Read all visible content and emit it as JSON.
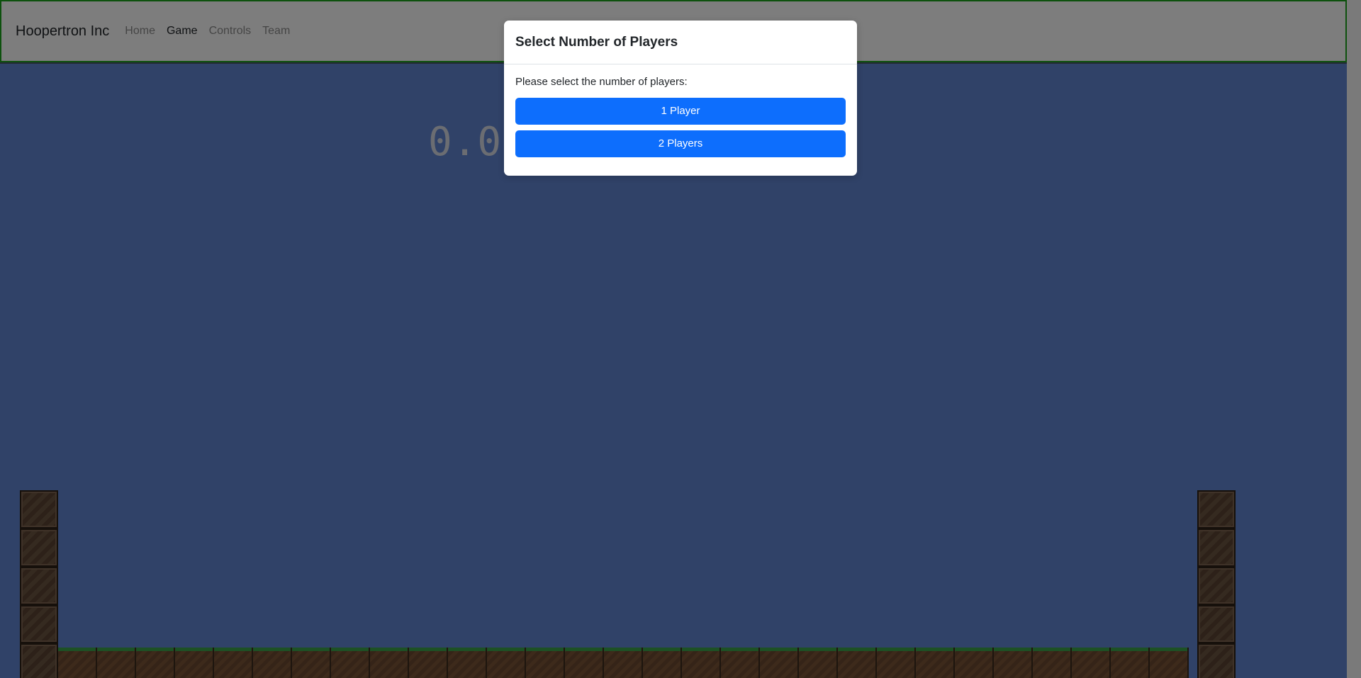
{
  "navbar": {
    "brand": "Hoopertron Inc",
    "links": [
      {
        "label": "Home",
        "active": false
      },
      {
        "label": "Game",
        "active": true
      },
      {
        "label": "Controls",
        "active": false
      },
      {
        "label": "Team",
        "active": false
      }
    ],
    "border_color": "#1aa21a"
  },
  "game": {
    "score": "0.0",
    "background_color": "#6185d1"
  },
  "modal": {
    "title": "Select Number of Players",
    "prompt": "Please select the number of players:",
    "buttons": {
      "one_player": "1 Player",
      "two_players": "2 Players"
    },
    "button_color": "#0d6efd"
  }
}
